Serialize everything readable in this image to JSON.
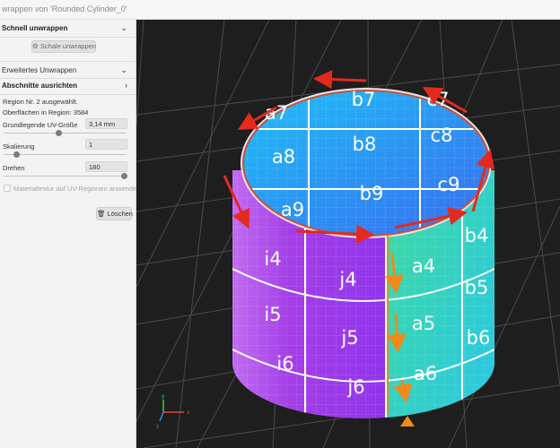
{
  "window": {
    "title": "wrappen von 'Rounded Cylinder_0'"
  },
  "panel": {
    "quick_unwrap": {
      "label": "Schnell unwrappen",
      "chevron": "chevron-down-icon",
      "button_label": "Schale unwrappen",
      "button_icon": "unwrap-icon"
    },
    "advanced_unwrap": {
      "label": "Erweitertes Unwrappen",
      "chevron": "chevron-down-icon"
    },
    "align_sections": {
      "label": "Abschnitte ausrichten",
      "chevron": "chevron-right-icon",
      "region_selected": "Region Nr. 2 ausgewählt.",
      "surfaces_in_region": "Oberflächen in Region: 3584",
      "uv_size_label": "Grundlegende UV-Größe",
      "uv_size_value": "3,14 mm",
      "scale_label": "Skalierung",
      "scale_value": "1",
      "rotate_label": "Drehen",
      "rotate_value": "180",
      "material_checkbox_label": "Materialtextur auf UV-Regionen anwenden",
      "material_checked": false,
      "delete_button": "Löschen",
      "delete_icon": "trash-icon"
    }
  },
  "viewport": {
    "top_cells": [
      "a7",
      "b7",
      "c7",
      "a8",
      "b8",
      "c8",
      "a9",
      "b9",
      "c9"
    ],
    "side_cells": [
      "i4",
      "j4",
      "a4",
      "b4",
      "i5",
      "j5",
      "a5",
      "b5",
      "i6",
      "j6",
      "a6",
      "b6"
    ],
    "axis_icon": "xyz-axis-icon",
    "seam_marker_icon": "seam-marker-icon",
    "colors": {
      "arrow_red": "#e42a1f",
      "arrow_orange": "#f08a1a",
      "top_blue": "#2c92f2",
      "side_purple": "#a43fe8",
      "side_green": "#3fdc9c"
    }
  }
}
